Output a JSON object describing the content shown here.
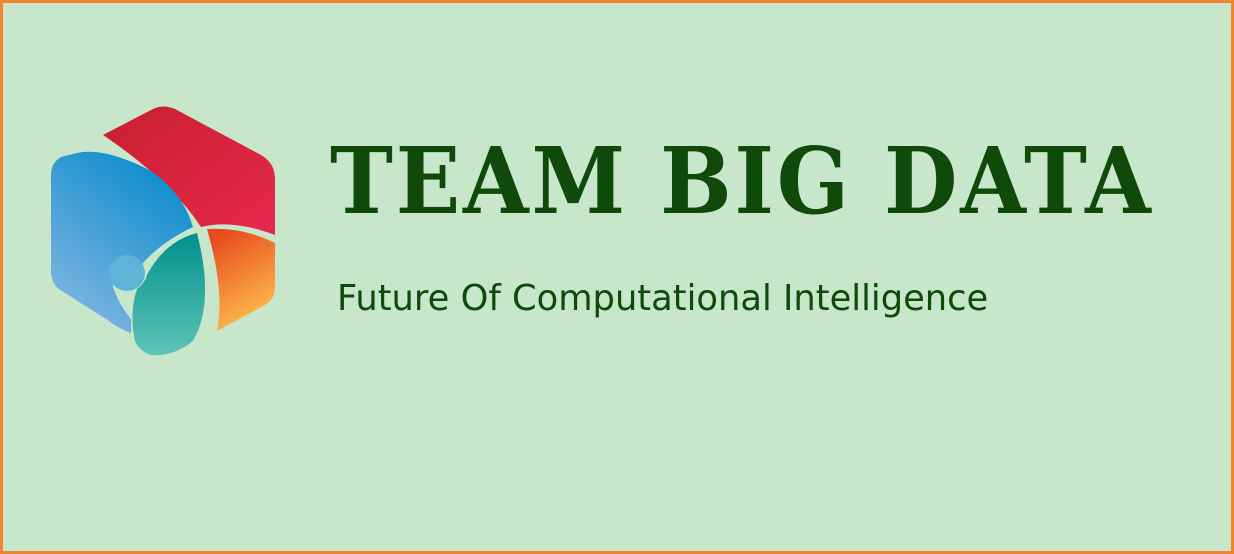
{
  "banner": {
    "title": "TEAM BIG DATA",
    "tagline": "Future Of Computational Intelligence"
  },
  "logo": {
    "icon": "hexagon-segmented-logo"
  },
  "colors": {
    "background": "#c7e6ca",
    "border": "#f0852e",
    "text": "#0f4a0a",
    "logo_red": "#dc2a44",
    "logo_blue": "#1a8ccc",
    "logo_teal": "#0a9a96",
    "logo_orange": "#f07828"
  }
}
